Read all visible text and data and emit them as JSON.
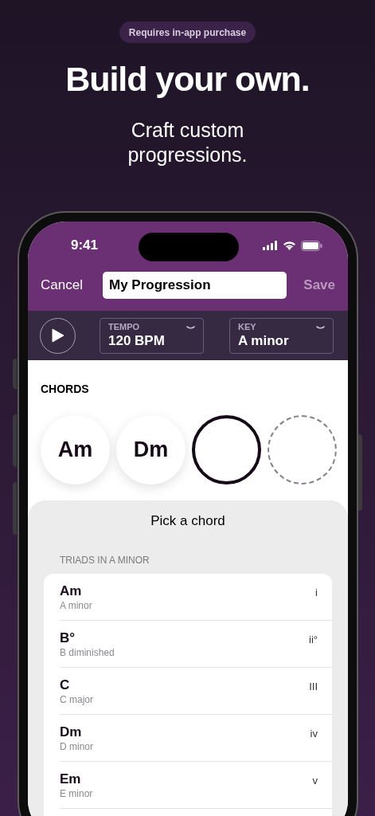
{
  "badge": "Requires in-app purchase",
  "headline": "Build your own.",
  "subtitle": "Craft custom progressions.",
  "status_bar": {
    "time": "9:41"
  },
  "nav": {
    "cancel": "Cancel",
    "title_value": "My Progression",
    "save": "Save",
    "save_disabled": true
  },
  "toolbar": {
    "pickers": [
      {
        "label": "TEMPO",
        "value": "120 BPM"
      },
      {
        "label": "KEY",
        "value": "A minor"
      }
    ]
  },
  "chords": {
    "heading": "CHORDS",
    "slots": [
      {
        "kind": "filled",
        "label": "Am"
      },
      {
        "kind": "filled",
        "label": "Dm"
      },
      {
        "kind": "current"
      },
      {
        "kind": "empty"
      }
    ]
  },
  "sheet": {
    "title": "Pick a chord",
    "section": "TRIADS IN A MINOR",
    "rows": [
      {
        "name": "Am",
        "description": "A minor",
        "numeral": "i"
      },
      {
        "name": "B°",
        "description": "B diminished",
        "numeral": "ii°"
      },
      {
        "name": "C",
        "description": "C major",
        "numeral": "III"
      },
      {
        "name": "Dm",
        "description": "D minor",
        "numeral": "iv"
      },
      {
        "name": "Em",
        "description": "E minor",
        "numeral": "v"
      }
    ]
  }
}
